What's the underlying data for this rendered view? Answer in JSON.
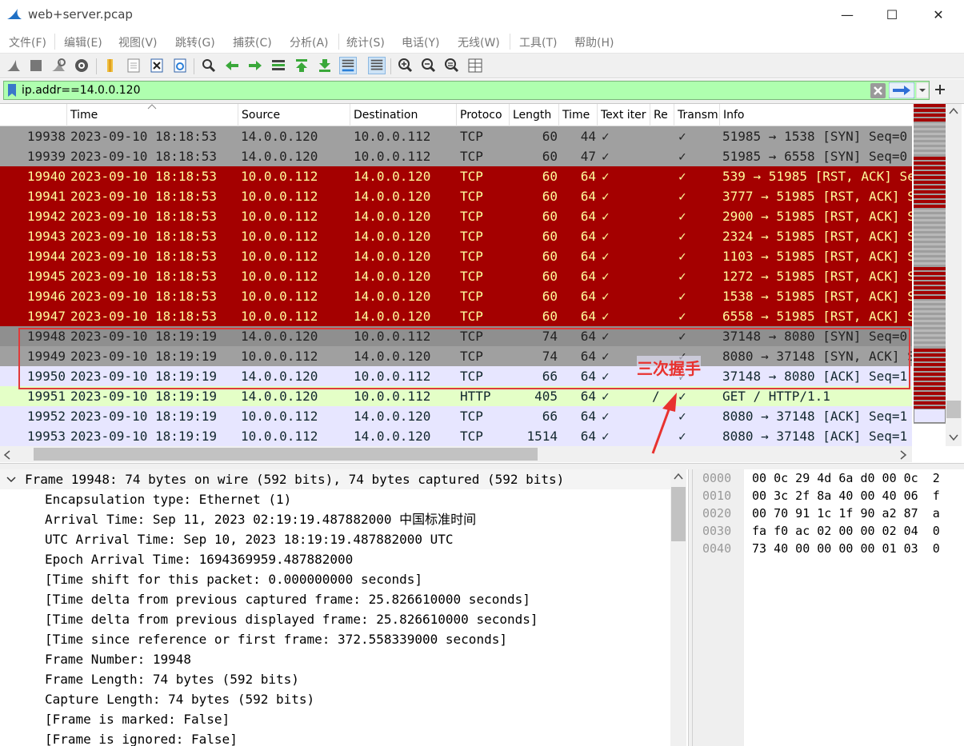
{
  "window": {
    "title": "web+server.pcap",
    "minimize": "—",
    "maximize": "☐",
    "close": "✕"
  },
  "menu": [
    "文件(F)",
    "编辑(E)",
    "视图(V)",
    "跳转(G)",
    "捕获(C)",
    "分析(A)",
    "统计(S)",
    "电话(Y)",
    "无线(W)",
    "工具(T)",
    "帮助(H)"
  ],
  "toolbar_icons": [
    "shark-fin-start-icon",
    "stop-icon",
    "restart-icon",
    "capture-options-icon",
    "open-file-icon",
    "file-icon",
    "close-file-icon",
    "reload-icon",
    "find-icon",
    "back-arrow-icon",
    "forward-arrow-icon",
    "go-to-packet-icon",
    "first-packet-icon",
    "last-packet-icon",
    "autoscroll-icon",
    "colorize-icon",
    "zoom-in-icon",
    "zoom-out-icon",
    "normal-size-icon",
    "resize-columns-icon"
  ],
  "filter": {
    "value": "ip.addr==14.0.0.120"
  },
  "columns": [
    "",
    "Time",
    "Source",
    "Destination",
    "Protoco",
    "Length",
    "Time",
    "Text iter",
    "Re",
    "Transm",
    "Info"
  ],
  "packets": [
    {
      "no": "19938",
      "time": "2023-09-10 18:18:53",
      "src": "14.0.0.120",
      "dst": "10.0.0.112",
      "proto": "TCP",
      "len": "60",
      "t2": "44",
      "text": "✓",
      "re": "",
      "trans": "✓",
      "info": "51985 → 1538 [SYN] Seq=0",
      "style": "gray"
    },
    {
      "no": "19939",
      "time": "2023-09-10 18:18:53",
      "src": "14.0.0.120",
      "dst": "10.0.0.112",
      "proto": "TCP",
      "len": "60",
      "t2": "47",
      "text": "✓",
      "re": "",
      "trans": "✓",
      "info": "51985 → 6558 [SYN] Seq=0",
      "style": "gray"
    },
    {
      "no": "19940",
      "time": "2023-09-10 18:18:53",
      "src": "10.0.0.112",
      "dst": "14.0.0.120",
      "proto": "TCP",
      "len": "60",
      "t2": "64",
      "text": "✓",
      "re": "",
      "trans": "✓",
      "info": "539 → 51985 [RST, ACK] Seq",
      "style": "red"
    },
    {
      "no": "19941",
      "time": "2023-09-10 18:18:53",
      "src": "10.0.0.112",
      "dst": "14.0.0.120",
      "proto": "TCP",
      "len": "60",
      "t2": "64",
      "text": "✓",
      "re": "",
      "trans": "✓",
      "info": "3777 → 51985 [RST, ACK] S",
      "style": "red"
    },
    {
      "no": "19942",
      "time": "2023-09-10 18:18:53",
      "src": "10.0.0.112",
      "dst": "14.0.0.120",
      "proto": "TCP",
      "len": "60",
      "t2": "64",
      "text": "✓",
      "re": "",
      "trans": "✓",
      "info": "2900 → 51985 [RST, ACK] S",
      "style": "red"
    },
    {
      "no": "19943",
      "time": "2023-09-10 18:18:53",
      "src": "10.0.0.112",
      "dst": "14.0.0.120",
      "proto": "TCP",
      "len": "60",
      "t2": "64",
      "text": "✓",
      "re": "",
      "trans": "✓",
      "info": "2324 → 51985 [RST, ACK] S",
      "style": "red"
    },
    {
      "no": "19944",
      "time": "2023-09-10 18:18:53",
      "src": "10.0.0.112",
      "dst": "14.0.0.120",
      "proto": "TCP",
      "len": "60",
      "t2": "64",
      "text": "✓",
      "re": "",
      "trans": "✓",
      "info": "1103 → 51985 [RST, ACK] S",
      "style": "red"
    },
    {
      "no": "19945",
      "time": "2023-09-10 18:18:53",
      "src": "10.0.0.112",
      "dst": "14.0.0.120",
      "proto": "TCP",
      "len": "60",
      "t2": "64",
      "text": "✓",
      "re": "",
      "trans": "✓",
      "info": "1272 → 51985 [RST, ACK] S",
      "style": "red"
    },
    {
      "no": "19946",
      "time": "2023-09-10 18:18:53",
      "src": "10.0.0.112",
      "dst": "14.0.0.120",
      "proto": "TCP",
      "len": "60",
      "t2": "64",
      "text": "✓",
      "re": "",
      "trans": "✓",
      "info": "1538 → 51985 [RST, ACK] S",
      "style": "red"
    },
    {
      "no": "19947",
      "time": "2023-09-10 18:18:53",
      "src": "10.0.0.112",
      "dst": "14.0.0.120",
      "proto": "TCP",
      "len": "60",
      "t2": "64",
      "text": "✓",
      "re": "",
      "trans": "✓",
      "info": "6558 → 51985 [RST, ACK] S",
      "style": "red"
    },
    {
      "no": "19948",
      "time": "2023-09-10 18:19:19",
      "src": "14.0.0.120",
      "dst": "10.0.0.112",
      "proto": "TCP",
      "len": "74",
      "t2": "64",
      "text": "✓",
      "re": "",
      "trans": "✓",
      "info": "37148 → 8080 [SYN] Seq=0",
      "style": "gray-sel"
    },
    {
      "no": "19949",
      "time": "2023-09-10 18:19:19",
      "src": "10.0.0.112",
      "dst": "14.0.0.120",
      "proto": "TCP",
      "len": "74",
      "t2": "64",
      "text": "✓",
      "re": "",
      "trans": "✓",
      "info": "8080 → 37148 [SYN, ACK] S",
      "style": "gray"
    },
    {
      "no": "19950",
      "time": "2023-09-10 18:19:19",
      "src": "14.0.0.120",
      "dst": "10.0.0.112",
      "proto": "TCP",
      "len": "66",
      "t2": "64",
      "text": "✓",
      "re": "",
      "trans": "✓",
      "info": "37148 → 8080 [ACK] Seq=1",
      "style": "lav"
    },
    {
      "no": "19951",
      "time": "2023-09-10 18:19:19",
      "src": "14.0.0.120",
      "dst": "10.0.0.112",
      "proto": "HTTP",
      "len": "405",
      "t2": "64",
      "text": "✓",
      "re": "/",
      "trans": "✓",
      "info": "GET / HTTP/1.1",
      "style": "green"
    },
    {
      "no": "19952",
      "time": "2023-09-10 18:19:19",
      "src": "10.0.0.112",
      "dst": "14.0.0.120",
      "proto": "TCP",
      "len": "66",
      "t2": "64",
      "text": "✓",
      "re": "",
      "trans": "✓",
      "info": "8080 → 37148 [ACK] Seq=1",
      "style": "lav"
    },
    {
      "no": "19953",
      "time": "2023-09-10 18:19:19",
      "src": "10.0.0.112",
      "dst": "14.0.0.120",
      "proto": "TCP",
      "len": "1514",
      "t2": "64",
      "text": "✓",
      "re": "",
      "trans": "✓",
      "info": "8080 → 37148 [ACK] Seq=1",
      "style": "lav"
    }
  ],
  "details": [
    "Frame 19948: 74 bytes on wire (592 bits), 74 bytes captured (592 bits)",
    "Encapsulation type: Ethernet (1)",
    "Arrival Time: Sep 11, 2023 02:19:19.487882000 中国标准时间",
    "UTC Arrival Time: Sep 10, 2023 18:19:19.487882000 UTC",
    "Epoch Arrival Time: 1694369959.487882000",
    "[Time shift for this packet: 0.000000000 seconds]",
    "[Time delta from previous captured frame: 25.826610000 seconds]",
    "[Time delta from previous displayed frame: 25.826610000 seconds]",
    "[Time since reference or first frame: 372.558339000 seconds]",
    "Frame Number: 19948",
    "Frame Length: 74 bytes (592 bits)",
    "Capture Length: 74 bytes (592 bits)",
    "[Frame is marked: False]",
    "[Frame is ignored: False]"
  ],
  "bytes": [
    {
      "offset": "0000",
      "hex": "00 0c 29 4d 6a d0 00 0c  2"
    },
    {
      "offset": "0010",
      "hex": "00 3c 2f 8a 40 00 40 06  f"
    },
    {
      "offset": "0020",
      "hex": "00 70 91 1c 1f 90 a2 87  a"
    },
    {
      "offset": "0030",
      "hex": "fa f0 ac 02 00 00 02 04  0"
    },
    {
      "offset": "0040",
      "hex": "73 40 00 00 00 00 01 03  0"
    }
  ],
  "annotation": {
    "label": "三次握手"
  },
  "colors": {
    "rst_row": "#a40000",
    "rst_text": "#fffc9c",
    "filter_ok": "#afffaf",
    "annotation": "#e03a3a"
  }
}
